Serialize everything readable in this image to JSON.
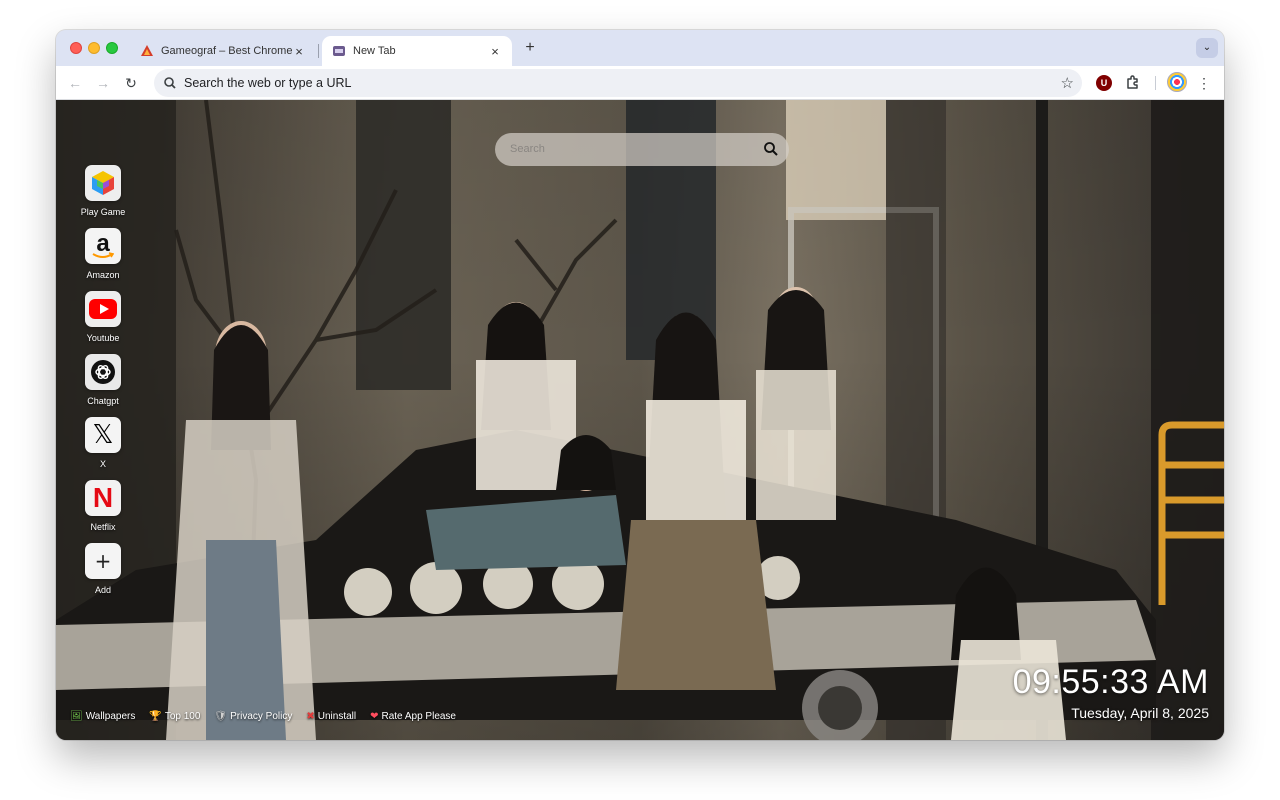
{
  "browser": {
    "tabs": [
      {
        "title": "Gameograf – Best Chrome Li",
        "close": "×"
      },
      {
        "title": "New Tab",
        "close": "×"
      }
    ],
    "new_tab": "+",
    "tab_search": "⌄",
    "nav": {
      "back": "←",
      "forward": "→",
      "reload": "↻"
    },
    "omnibox_placeholder": "Search the web or type a URL",
    "star": "☆",
    "menu": "⋮",
    "extension_ublock": "U"
  },
  "newtab": {
    "search_placeholder": "Search",
    "shortcuts": [
      {
        "label": "Play Game",
        "icon": "cube-icon"
      },
      {
        "label": "Amazon",
        "icon": "amazon-icon",
        "glyph": "a"
      },
      {
        "label": "Youtube",
        "icon": "youtube-icon"
      },
      {
        "label": "Chatgpt",
        "icon": "chatgpt-icon"
      },
      {
        "label": "X",
        "icon": "x-icon",
        "glyph": "𝕏"
      },
      {
        "label": "Netflix",
        "icon": "netflix-icon",
        "glyph": "N"
      },
      {
        "label": "Add",
        "icon": "plus-icon",
        "glyph": "+"
      }
    ],
    "footer_links": [
      {
        "emoji": "🖼",
        "label": "Wallpapers"
      },
      {
        "emoji": "🏆",
        "label": "Top 100"
      },
      {
        "emoji": "🛡",
        "label": "Privacy Policy"
      },
      {
        "emoji": "✖",
        "label": "Uninstall"
      },
      {
        "emoji": "❤",
        "label": "Rate App Please"
      }
    ],
    "clock": "09:55:33 AM",
    "date": "Tuesday, April 8, 2025"
  },
  "colors": {
    "youtube": "#ff0000",
    "netflix": "#e50914",
    "ublock": "#800000"
  }
}
